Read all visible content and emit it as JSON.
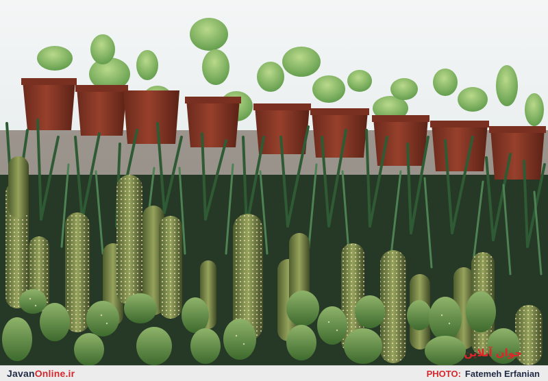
{
  "photo": {
    "alt": "Potted succulents and cacti on a window sill"
  },
  "watermark": {
    "text": "جوان آنلاین"
  },
  "caption": {
    "site_prefix": "Javan",
    "site_suffix": "Online.ir",
    "credit_label": "PHOTO:",
    "credit_name": "Fatemeh Erfanian"
  },
  "colors": {
    "brand_red": "#d3282e",
    "navy": "#1f2a44"
  }
}
